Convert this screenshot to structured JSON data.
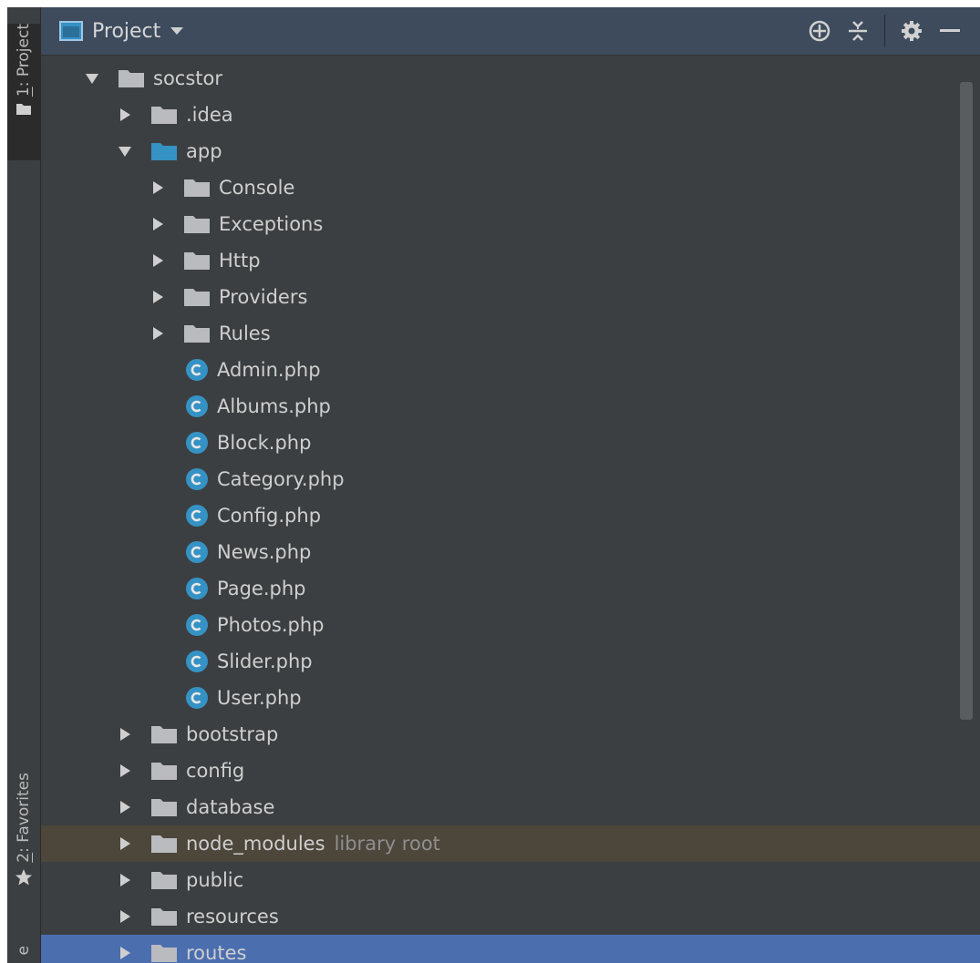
{
  "colors": {
    "background": "#3c3f41",
    "header": "#3d4b5c",
    "folder": "#b9bbbe",
    "folder_open": "#3592c4",
    "class_icon": "#3592c4",
    "highlight_row": "#4c463b",
    "selected_row": "#4b6eaf"
  },
  "sidebar": {
    "project_tab": {
      "number": "1",
      "label": ": Project"
    },
    "favorites_tab": {
      "number": "2",
      "label": ": Favorites"
    },
    "partial_tab_text": "e"
  },
  "header": {
    "title": "Project",
    "icons": [
      "locate-icon",
      "collapse-all-icon",
      "settings-icon",
      "minimize-icon"
    ]
  },
  "tree": [
    {
      "label": "socstor",
      "type": "folder",
      "expanded": true
    },
    {
      "label": ".idea",
      "type": "folder",
      "expanded": false
    },
    {
      "label": "app",
      "type": "folder",
      "expanded": true
    },
    {
      "label": "Console",
      "type": "folder",
      "expanded": false
    },
    {
      "label": "Exceptions",
      "type": "folder",
      "expanded": false
    },
    {
      "label": "Http",
      "type": "folder",
      "expanded": false
    },
    {
      "label": "Providers",
      "type": "folder",
      "expanded": false
    },
    {
      "label": "Rules",
      "type": "folder",
      "expanded": false
    },
    {
      "label": "Admin.php",
      "type": "class"
    },
    {
      "label": "Albums.php",
      "type": "class"
    },
    {
      "label": "Block.php",
      "type": "class"
    },
    {
      "label": "Category.php",
      "type": "class"
    },
    {
      "label": "Config.php",
      "type": "class"
    },
    {
      "label": "News.php",
      "type": "class"
    },
    {
      "label": "Page.php",
      "type": "class"
    },
    {
      "label": "Photos.php",
      "type": "class"
    },
    {
      "label": "Slider.php",
      "type": "class"
    },
    {
      "label": "User.php",
      "type": "class"
    },
    {
      "label": "bootstrap",
      "type": "folder",
      "expanded": false
    },
    {
      "label": "config",
      "type": "folder",
      "expanded": false
    },
    {
      "label": "database",
      "type": "folder",
      "expanded": false
    },
    {
      "label": "node_modules",
      "hint": "library root",
      "type": "folder",
      "expanded": false
    },
    {
      "label": "public",
      "type": "folder",
      "expanded": false
    },
    {
      "label": "resources",
      "type": "folder",
      "expanded": false
    },
    {
      "label": "routes",
      "type": "folder",
      "expanded": false
    }
  ]
}
